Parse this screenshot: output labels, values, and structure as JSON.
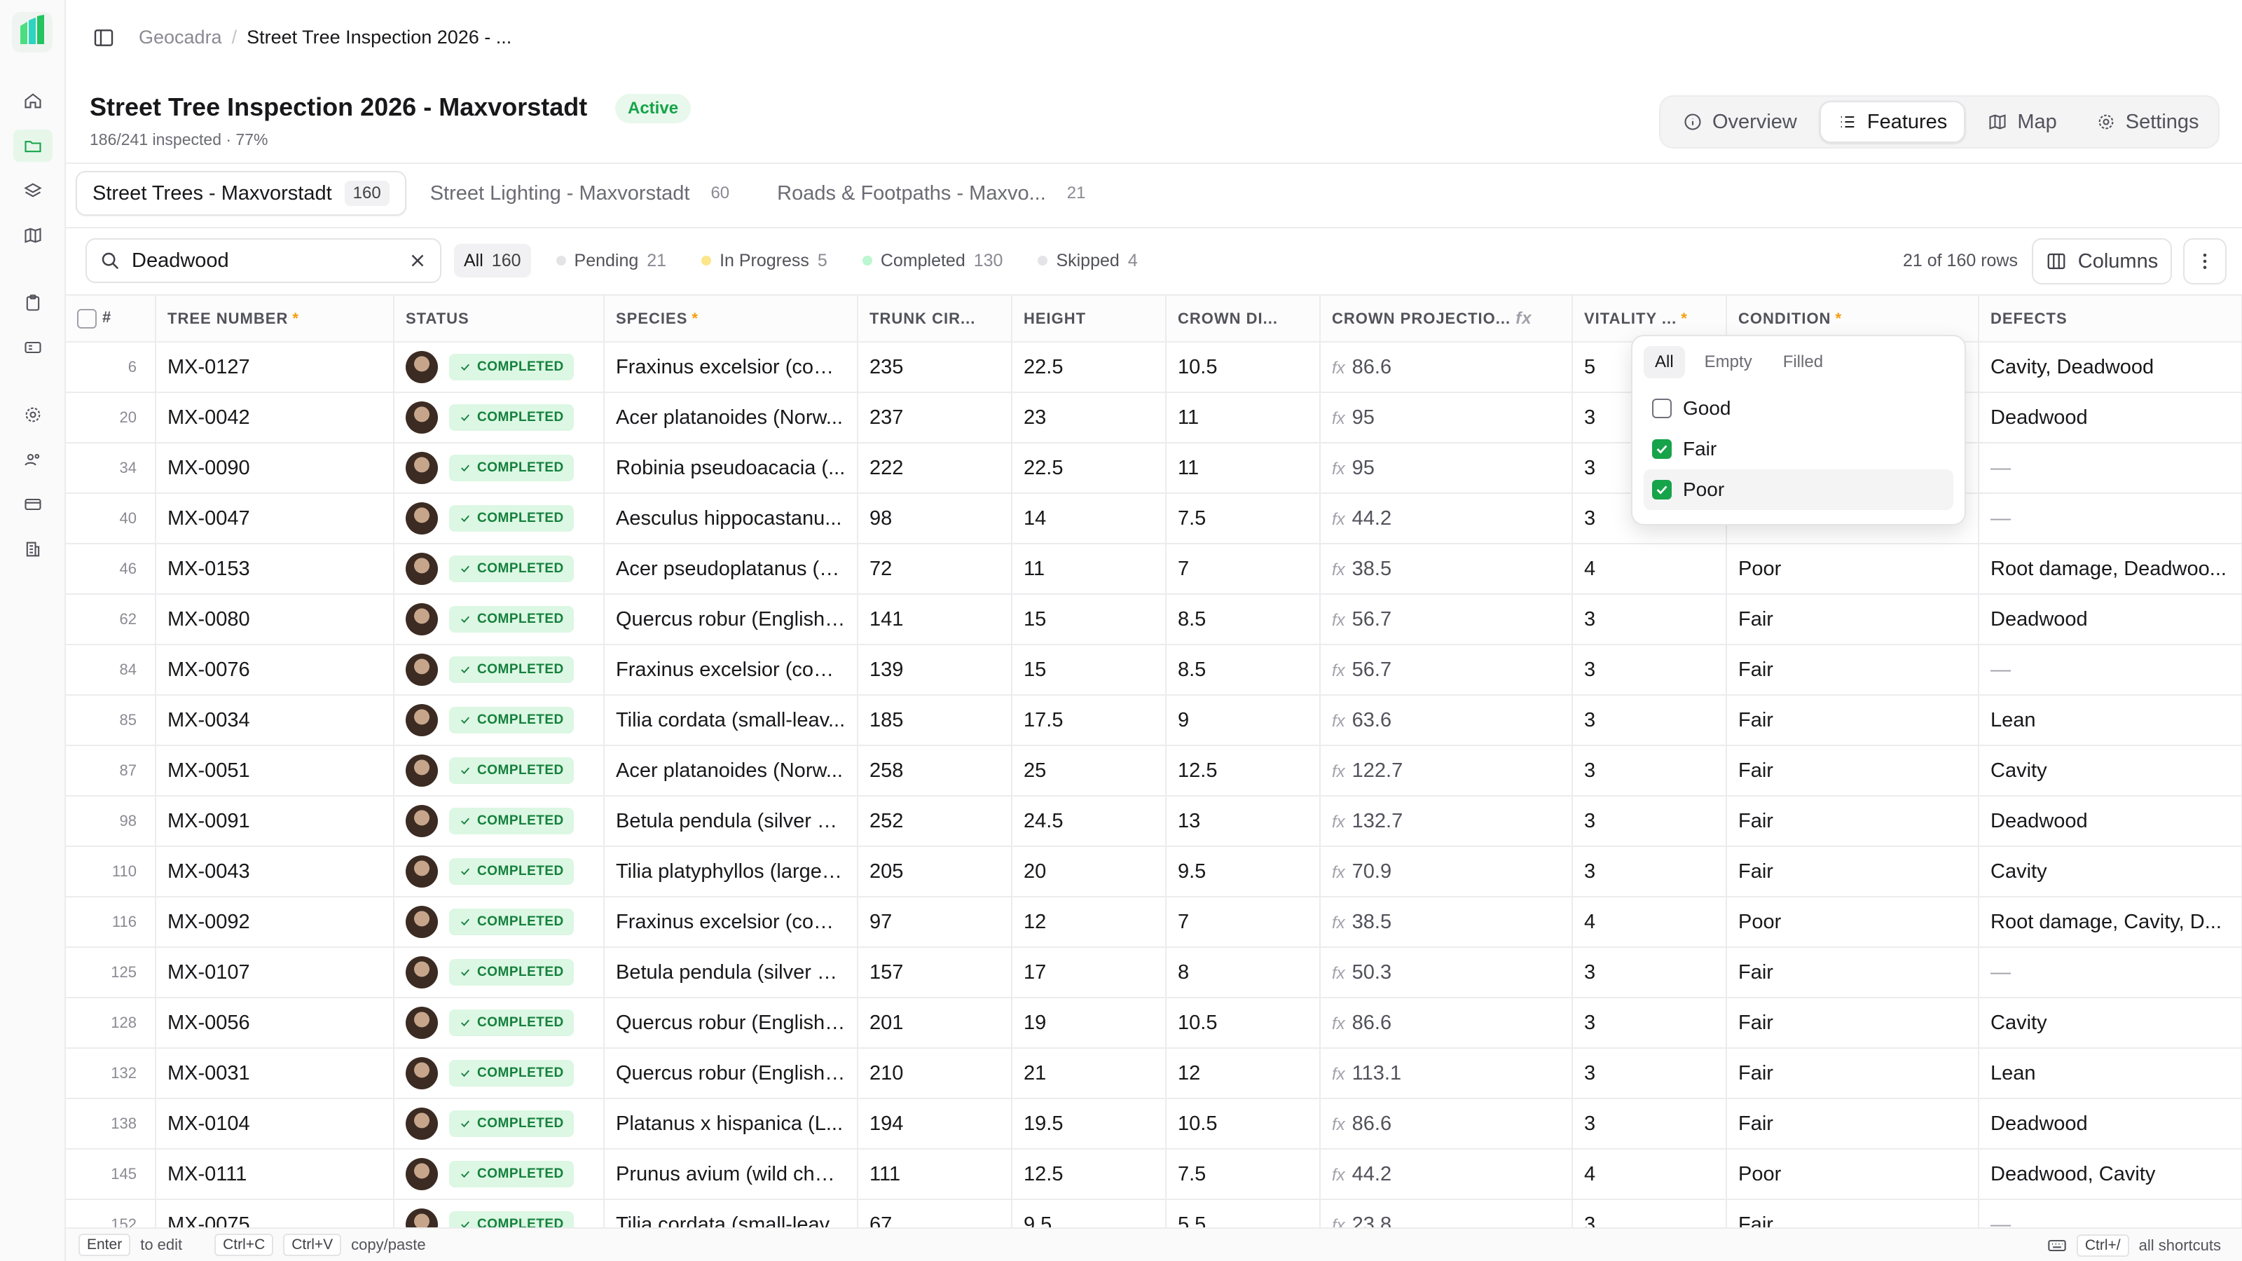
{
  "breadcrumb": {
    "root": "Geocadra",
    "separator": "/",
    "current": "Street Tree Inspection 2026 - ..."
  },
  "header": {
    "title": "Street Tree Inspection 2026 - Maxvorstadt",
    "status": "Active",
    "progress_text": "186/241 inspected · 77%",
    "progress": {
      "inspected": 186,
      "total": 241,
      "percent": 77
    }
  },
  "views": [
    {
      "label": "Overview",
      "icon": "info-icon",
      "active": false
    },
    {
      "label": "Features",
      "icon": "list-icon",
      "active": true
    },
    {
      "label": "Map",
      "icon": "map-icon",
      "active": false
    },
    {
      "label": "Settings",
      "icon": "gear-icon",
      "active": false
    }
  ],
  "layer_tabs": [
    {
      "label": "Street Trees - Maxvorstadt",
      "count": "160",
      "active": true
    },
    {
      "label": "Street Lighting - Maxvorstadt",
      "count": "60",
      "active": false
    },
    {
      "label": "Roads & Footpaths - Maxvo...",
      "count": "21",
      "active": false
    }
  ],
  "search": {
    "value": "Deadwood"
  },
  "status_filters": [
    {
      "label": "All",
      "count": "160",
      "active": true,
      "color": ""
    },
    {
      "label": "Pending",
      "count": "21",
      "active": false,
      "color": "#e4e4e7"
    },
    {
      "label": "In Progress",
      "count": "5",
      "active": false,
      "color": "#fde68a"
    },
    {
      "label": "Completed",
      "count": "130",
      "active": false,
      "color": "#bbf7d0"
    },
    {
      "label": "Skipped",
      "count": "4",
      "active": false,
      "color": "#e4e4e7"
    }
  ],
  "toolbar": {
    "row_count": "21 of 160 rows",
    "columns_label": "Columns"
  },
  "table": {
    "columns": [
      {
        "key": "idx",
        "label": "#",
        "required": false
      },
      {
        "key": "tree",
        "label": "TREE NUMBER",
        "required": true
      },
      {
        "key": "status",
        "label": "STATUS",
        "required": false
      },
      {
        "key": "species",
        "label": "SPECIES",
        "required": true
      },
      {
        "key": "trunk",
        "label": "TRUNK CIR...",
        "required": false
      },
      {
        "key": "height",
        "label": "HEIGHT",
        "required": false
      },
      {
        "key": "crown",
        "label": "CROWN DI...",
        "required": false
      },
      {
        "key": "proj",
        "label": "CROWN PROJECTIO...",
        "required": false,
        "formula": true
      },
      {
        "key": "vitality",
        "label": "VITALITY ...",
        "required": true
      },
      {
        "key": "condition",
        "label": "CONDITION",
        "required": true
      },
      {
        "key": "defects",
        "label": "DEFECTS",
        "required": false
      }
    ],
    "status_label": "COMPLETED",
    "formula_symbol": "fx",
    "rows": [
      {
        "idx": "6",
        "tree": "MX-0127",
        "species": "Fraxinus excelsior (com...",
        "trunk": "235",
        "height": "22.5",
        "crown": "10.5",
        "proj": "86.6",
        "vitality": "5",
        "condition": "",
        "defects": "Cavity, Deadwood"
      },
      {
        "idx": "20",
        "tree": "MX-0042",
        "species": "Acer platanoides (Norw...",
        "trunk": "237",
        "height": "23",
        "crown": "11",
        "proj": "95",
        "vitality": "3",
        "condition": "",
        "defects": "Deadwood"
      },
      {
        "idx": "34",
        "tree": "MX-0090",
        "species": "Robinia pseudoacacia (...",
        "trunk": "222",
        "height": "22.5",
        "crown": "11",
        "proj": "95",
        "vitality": "3",
        "condition": "",
        "defects": "—"
      },
      {
        "idx": "40",
        "tree": "MX-0047",
        "species": "Aesculus hippocastanu...",
        "trunk": "98",
        "height": "14",
        "crown": "7.5",
        "proj": "44.2",
        "vitality": "3",
        "condition": "",
        "defects": "—"
      },
      {
        "idx": "46",
        "tree": "MX-0153",
        "species": "Acer pseudoplatanus (s...",
        "trunk": "72",
        "height": "11",
        "crown": "7",
        "proj": "38.5",
        "vitality": "4",
        "condition": "Poor",
        "defects": "Root damage, Deadwoo..."
      },
      {
        "idx": "62",
        "tree": "MX-0080",
        "species": "Quercus robur (English ...",
        "trunk": "141",
        "height": "15",
        "crown": "8.5",
        "proj": "56.7",
        "vitality": "3",
        "condition": "Fair",
        "defects": "Deadwood"
      },
      {
        "idx": "84",
        "tree": "MX-0076",
        "species": "Fraxinus excelsior (com...",
        "trunk": "139",
        "height": "15",
        "crown": "8.5",
        "proj": "56.7",
        "vitality": "3",
        "condition": "Fair",
        "defects": "—"
      },
      {
        "idx": "85",
        "tree": "MX-0034",
        "species": "Tilia cordata (small-leav...",
        "trunk": "185",
        "height": "17.5",
        "crown": "9",
        "proj": "63.6",
        "vitality": "3",
        "condition": "Fair",
        "defects": "Lean"
      },
      {
        "idx": "87",
        "tree": "MX-0051",
        "species": "Acer platanoides (Norw...",
        "trunk": "258",
        "height": "25",
        "crown": "12.5",
        "proj": "122.7",
        "vitality": "3",
        "condition": "Fair",
        "defects": "Cavity"
      },
      {
        "idx": "98",
        "tree": "MX-0091",
        "species": "Betula pendula (silver bi...",
        "trunk": "252",
        "height": "24.5",
        "crown": "13",
        "proj": "132.7",
        "vitality": "3",
        "condition": "Fair",
        "defects": "Deadwood"
      },
      {
        "idx": "110",
        "tree": "MX-0043",
        "species": "Tilia platyphyllos (large-l...",
        "trunk": "205",
        "height": "20",
        "crown": "9.5",
        "proj": "70.9",
        "vitality": "3",
        "condition": "Fair",
        "defects": "Cavity"
      },
      {
        "idx": "116",
        "tree": "MX-0092",
        "species": "Fraxinus excelsior (com...",
        "trunk": "97",
        "height": "12",
        "crown": "7",
        "proj": "38.5",
        "vitality": "4",
        "condition": "Poor",
        "defects": "Root damage, Cavity, D..."
      },
      {
        "idx": "125",
        "tree": "MX-0107",
        "species": "Betula pendula (silver bi...",
        "trunk": "157",
        "height": "17",
        "crown": "8",
        "proj": "50.3",
        "vitality": "3",
        "condition": "Fair",
        "defects": "—"
      },
      {
        "idx": "128",
        "tree": "MX-0056",
        "species": "Quercus robur (English ...",
        "trunk": "201",
        "height": "19",
        "crown": "10.5",
        "proj": "86.6",
        "vitality": "3",
        "condition": "Fair",
        "defects": "Cavity"
      },
      {
        "idx": "132",
        "tree": "MX-0031",
        "species": "Quercus robur (English ...",
        "trunk": "210",
        "height": "21",
        "crown": "12",
        "proj": "113.1",
        "vitality": "3",
        "condition": "Fair",
        "defects": "Lean"
      },
      {
        "idx": "138",
        "tree": "MX-0104",
        "species": "Platanus x hispanica (L...",
        "trunk": "194",
        "height": "19.5",
        "crown": "10.5",
        "proj": "86.6",
        "vitality": "3",
        "condition": "Fair",
        "defects": "Deadwood"
      },
      {
        "idx": "145",
        "tree": "MX-0111",
        "species": "Prunus avium (wild cher...",
        "trunk": "111",
        "height": "12.5",
        "crown": "7.5",
        "proj": "44.2",
        "vitality": "4",
        "condition": "Poor",
        "defects": "Deadwood, Cavity"
      },
      {
        "idx": "152",
        "tree": "MX-0075",
        "species": "Tilia cordata (small-leav...",
        "trunk": "67",
        "height": "9.5",
        "crown": "5.5",
        "proj": "23.8",
        "vitality": "3",
        "condition": "Fair",
        "defects": "—"
      }
    ]
  },
  "condition_filter": {
    "tabs": [
      {
        "label": "All",
        "active": true
      },
      {
        "label": "Empty",
        "active": false
      },
      {
        "label": "Filled",
        "active": false
      }
    ],
    "options": [
      {
        "label": "Good",
        "checked": false
      },
      {
        "label": "Fair",
        "checked": true
      },
      {
        "label": "Poor",
        "checked": true
      }
    ]
  },
  "footer": {
    "edit_key": "Enter",
    "edit_label": "to edit",
    "copy_key": "Ctrl+C",
    "paste_key": "Ctrl+V",
    "copy_label": "copy/paste",
    "shortcuts_key": "Ctrl+/",
    "shortcuts_label": "all shortcuts"
  },
  "colors": {
    "accent": "#16a34a",
    "badge_bg": "#dcf7e3",
    "required": "#f59e0b"
  }
}
